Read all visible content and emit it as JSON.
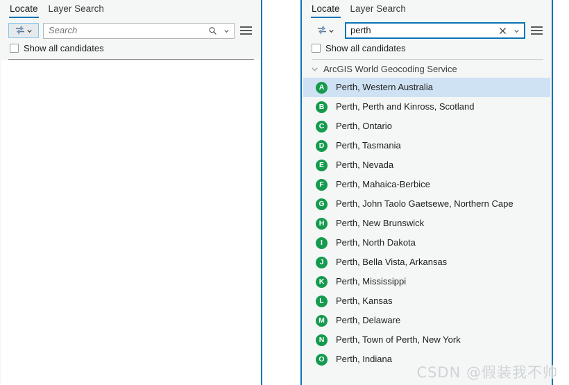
{
  "colors": {
    "panel_border": "#0b73b4",
    "accent": "#0b73b4",
    "badge_green": "#159b4e",
    "selection": "#cfe2f3",
    "panel_bg": "#f5f7f7"
  },
  "left_panel": {
    "tabs": [
      {
        "label": "Locate",
        "active": true
      },
      {
        "label": "Layer Search",
        "active": false
      }
    ],
    "locator_button": {
      "icon": "locator-settings-icon",
      "dropdown_icon": "chevron-down-icon"
    },
    "search": {
      "value": "",
      "placeholder": "Search",
      "search_icon": "search-icon",
      "dropdown_icon": "chevron-down-icon"
    },
    "menu_icon": "hamburger-menu-icon",
    "show_all_candidates": {
      "label": "Show all candidates",
      "checked": false
    }
  },
  "right_panel": {
    "tabs": [
      {
        "label": "Locate",
        "active": true
      },
      {
        "label": "Layer Search",
        "active": false
      }
    ],
    "locator_button": {
      "icon": "locator-settings-icon",
      "dropdown_icon": "chevron-down-icon"
    },
    "search": {
      "value": "perth",
      "placeholder": "Search",
      "clear_icon": "clear-x-icon",
      "dropdown_icon": "chevron-down-icon",
      "focused": true
    },
    "menu_icon": "hamburger-menu-icon",
    "show_all_candidates": {
      "label": "Show all candidates",
      "checked": false
    },
    "group": {
      "title": "ArcGIS World Geocoding Service",
      "expanded": true,
      "chevron_icon": "chevron-down-icon"
    },
    "results": [
      {
        "key": "A",
        "label": "Perth, Western Australia",
        "selected": true
      },
      {
        "key": "B",
        "label": "Perth, Perth and Kinross, Scotland",
        "selected": false
      },
      {
        "key": "C",
        "label": "Perth, Ontario",
        "selected": false
      },
      {
        "key": "D",
        "label": "Perth, Tasmania",
        "selected": false
      },
      {
        "key": "E",
        "label": "Perth, Nevada",
        "selected": false
      },
      {
        "key": "F",
        "label": "Perth, Mahaica-Berbice",
        "selected": false
      },
      {
        "key": "G",
        "label": "Perth, John Taolo Gaetsewe, Northern Cape",
        "selected": false
      },
      {
        "key": "H",
        "label": "Perth, New Brunswick",
        "selected": false
      },
      {
        "key": "I",
        "label": "Perth, North Dakota",
        "selected": false
      },
      {
        "key": "J",
        "label": "Perth, Bella Vista, Arkansas",
        "selected": false
      },
      {
        "key": "K",
        "label": "Perth, Mississippi",
        "selected": false
      },
      {
        "key": "L",
        "label": "Perth, Kansas",
        "selected": false
      },
      {
        "key": "M",
        "label": "Perth, Delaware",
        "selected": false
      },
      {
        "key": "N",
        "label": "Perth, Town of Perth, New York",
        "selected": false
      },
      {
        "key": "O",
        "label": "Perth, Indiana",
        "selected": false
      }
    ]
  },
  "watermark": {
    "text": "CSDN @假装我不帅"
  }
}
